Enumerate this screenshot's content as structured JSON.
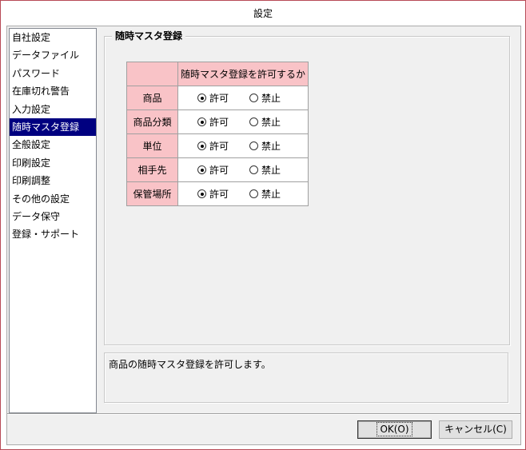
{
  "window": {
    "title": "設定"
  },
  "nav": {
    "items": [
      {
        "label": "自社設定",
        "selected": false
      },
      {
        "label": "データファイル",
        "selected": false
      },
      {
        "label": "パスワード",
        "selected": false
      },
      {
        "label": "在庫切れ警告",
        "selected": false
      },
      {
        "label": "入力設定",
        "selected": false
      },
      {
        "label": "随時マスタ登録",
        "selected": true
      },
      {
        "label": "全般設定",
        "selected": false
      },
      {
        "label": "印刷設定",
        "selected": false
      },
      {
        "label": "印刷調整",
        "selected": false
      },
      {
        "label": "その他の設定",
        "selected": false
      },
      {
        "label": "データ保守",
        "selected": false
      },
      {
        "label": "登録・サポート",
        "selected": false
      }
    ]
  },
  "group": {
    "title": "随時マスタ登録",
    "column_header": "随時マスタ登録を許可するか",
    "option_allow": "許可",
    "option_deny": "禁止",
    "rows": [
      {
        "label": "商品",
        "value": "許可"
      },
      {
        "label": "商品分類",
        "value": "許可"
      },
      {
        "label": "単位",
        "value": "許可"
      },
      {
        "label": "相手先",
        "value": "許可"
      },
      {
        "label": "保管場所",
        "value": "許可"
      }
    ]
  },
  "description": "商品の随時マスタ登録を許可します。",
  "buttons": {
    "ok": "OK(O)",
    "cancel": "キャンセル(C)"
  },
  "colors": {
    "header_bg": "#f9c3c7",
    "selection_bg": "#000080",
    "window_border": "#b84a56"
  }
}
